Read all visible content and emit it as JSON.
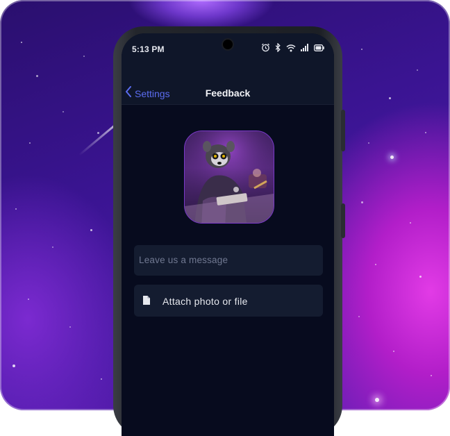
{
  "status_bar": {
    "time": "5:13 PM",
    "icons": [
      "alarm-icon",
      "bluetooth-icon",
      "wifi-icon",
      "signal-icon",
      "battery-icon"
    ]
  },
  "nav": {
    "back_label": "Settings",
    "title": "Feedback"
  },
  "avatar": {
    "alt": "lemur at desk illustration"
  },
  "message_field": {
    "placeholder": "Leave us a message",
    "value": ""
  },
  "attach": {
    "label": "Attach photo or file",
    "icon": "file-icon"
  },
  "colors": {
    "accent": "#5b6cf0",
    "screen_bg": "#070b1e",
    "field_bg": "#141c30"
  }
}
